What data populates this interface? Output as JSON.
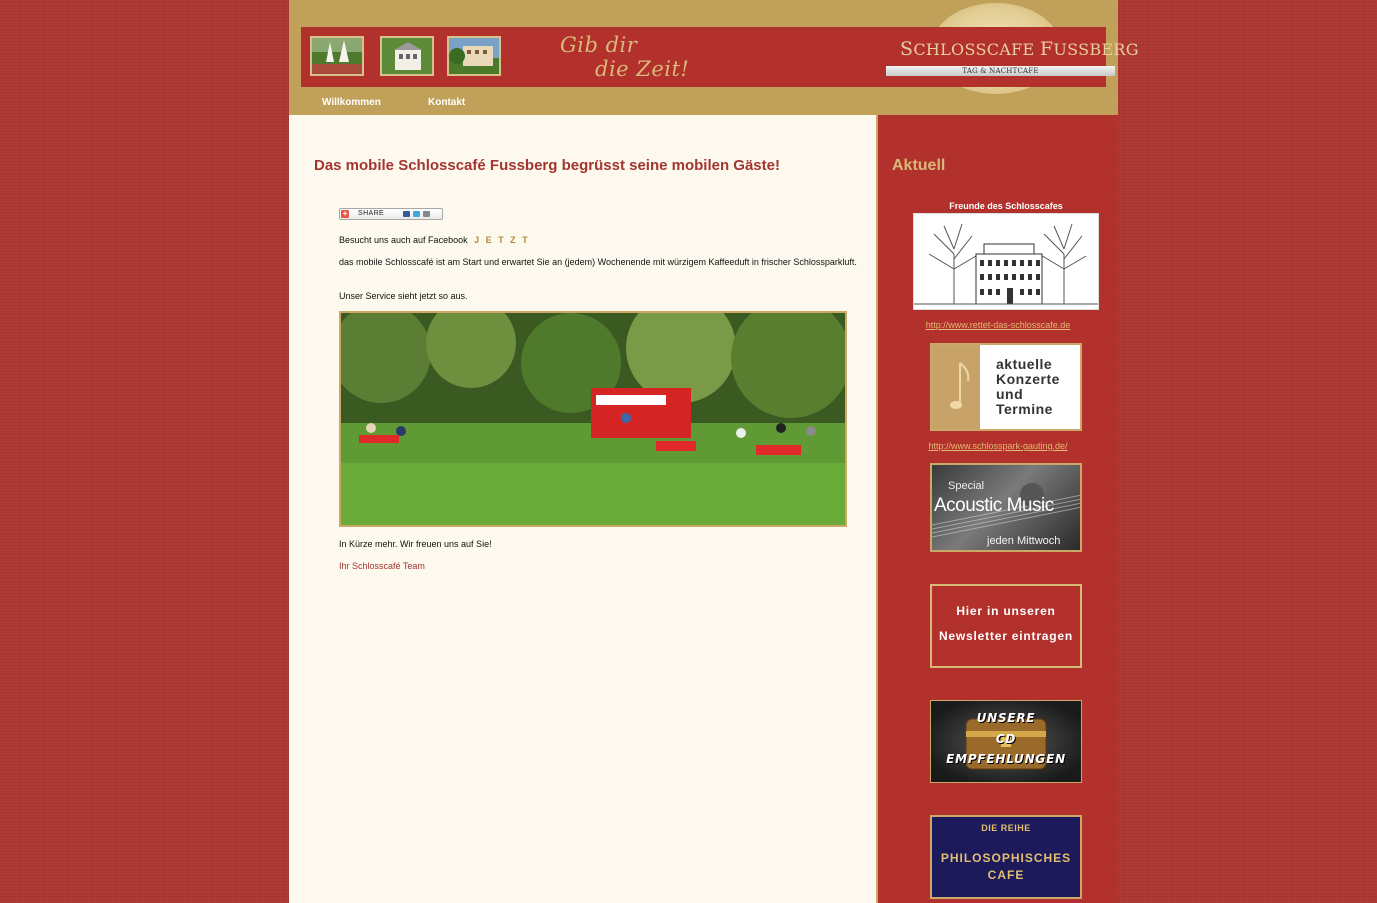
{
  "header": {
    "slogan_line1": "Gib dir",
    "slogan_line2": "die Zeit!",
    "logo_title_big1": "S",
    "logo_title_rest1": "CHLOSSCAFE ",
    "logo_title_big2": "F",
    "logo_title_rest2": "USSBERG",
    "logo_subtitle": "TAG & NACHTCAFE"
  },
  "nav": {
    "items": [
      {
        "label": "Willkommen"
      },
      {
        "label": "Kontakt"
      }
    ]
  },
  "main": {
    "heading": "Das mobile Schlosscafé Fussberg begrüsst seine mobilen Gäste!",
    "share_label": "SHARE",
    "facebook_text": "Besucht uns auch auf Facebook",
    "facebook_link": "J E T Z T",
    "intro_text": "das mobile Schlosscafé ist am Start und erwartet Sie an (jedem) Wochenende mit würzigem Kaffeeduft in frischer Schlossparkluft.",
    "service_text": "Unser Service sieht jetzt so aus.",
    "closing_text": "In Kürze mehr. Wir freuen uns auf Sie!",
    "signature": "Ihr Schlosscafé Team"
  },
  "sidebar": {
    "heading": "Aktuell",
    "friends_label": "Freunde des Schlosscafes",
    "friends_link": "http://www.rettet-das-schlosscafe.de",
    "konzerte_lines": [
      "aktuelle",
      "Konzerte",
      "und",
      "Termine"
    ],
    "schlosspark_link": "http://www.schlosspark-gauting.de/",
    "acoustic_special": "Special",
    "acoustic_title": "Acoustic Music",
    "acoustic_sub": "jeden Mittwoch",
    "newsletter_line1": "Hier in unseren",
    "newsletter_line2": "Newsletter eintragen",
    "cd_lines": [
      "UNSERE",
      "CD",
      "EMPFEHLUNGEN"
    ],
    "philo_line1": "DIE REIHE",
    "philo_line2": "PHILOSOPHISCHES",
    "philo_line3": "CAFE"
  },
  "colors": {
    "background": "#b23a35",
    "header_gold": "#c1a05a",
    "banner_red": "#b2312d",
    "content_bg": "#fdf9ee",
    "heading_red": "#a33530",
    "link_gold": "#b08a3c"
  }
}
